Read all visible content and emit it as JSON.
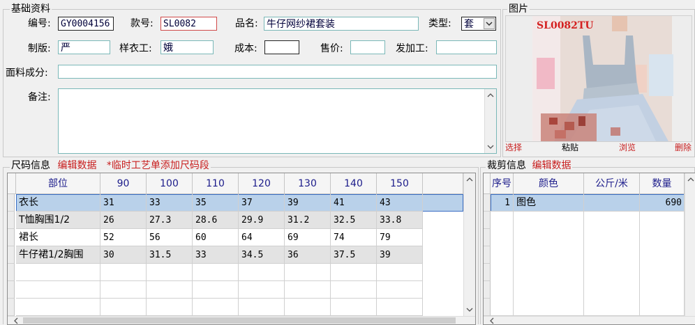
{
  "basic": {
    "title": "基础资料",
    "labels": {
      "code": "编号:",
      "style_no": "款号:",
      "name": "品名:",
      "type": "类型:",
      "maker": "制版:",
      "sample_worker": "样衣工:",
      "cost": "成本:",
      "price": "售价:",
      "processor": "发加工:",
      "fabric": "面料成分:",
      "remarks": "备注:"
    },
    "values": {
      "code": "GY0004156",
      "style_no": "SL0082",
      "name": "牛仔网纱裙套装",
      "type": "套",
      "maker": "严",
      "sample_worker": "娥",
      "cost": "",
      "price": "",
      "processor": "",
      "fabric": "",
      "remarks": ""
    }
  },
  "picture": {
    "title": "图片",
    "image_text": "SL0082TU",
    "buttons": {
      "select": "选择",
      "paste": "粘贴",
      "browse": "浏览",
      "delete": "删除"
    }
  },
  "size": {
    "title": "尺码信息",
    "edit_link": "编辑数据",
    "note": "*临时工艺单添加尺码段",
    "headers": [
      "部位",
      "90",
      "100",
      "110",
      "120",
      "130",
      "140",
      "150"
    ],
    "rows": [
      [
        "衣长",
        "31",
        "33",
        "35",
        "37",
        "39",
        "41",
        "43"
      ],
      [
        "T恤胸围1/2",
        "26",
        "27.3",
        "28.6",
        "29.9",
        "31.2",
        "32.5",
        "33.8"
      ],
      [
        "裙长",
        "52",
        "56",
        "60",
        "64",
        "69",
        "74",
        "79"
      ],
      [
        "牛仔裙1/2胸围",
        "30",
        "31.5",
        "33",
        "34.5",
        "36",
        "37.5",
        "39"
      ]
    ]
  },
  "cut": {
    "title": "裁剪信息",
    "edit_link": "编辑数据",
    "headers": [
      "序号",
      "颜色",
      "公斤/米",
      "数量"
    ],
    "rows": [
      [
        "1",
        "图色",
        "",
        "690"
      ]
    ]
  },
  "colors": {
    "selected_row": "#b9d1ea",
    "link_red": "#c81e1e",
    "header_text": "#1b1b8a"
  }
}
